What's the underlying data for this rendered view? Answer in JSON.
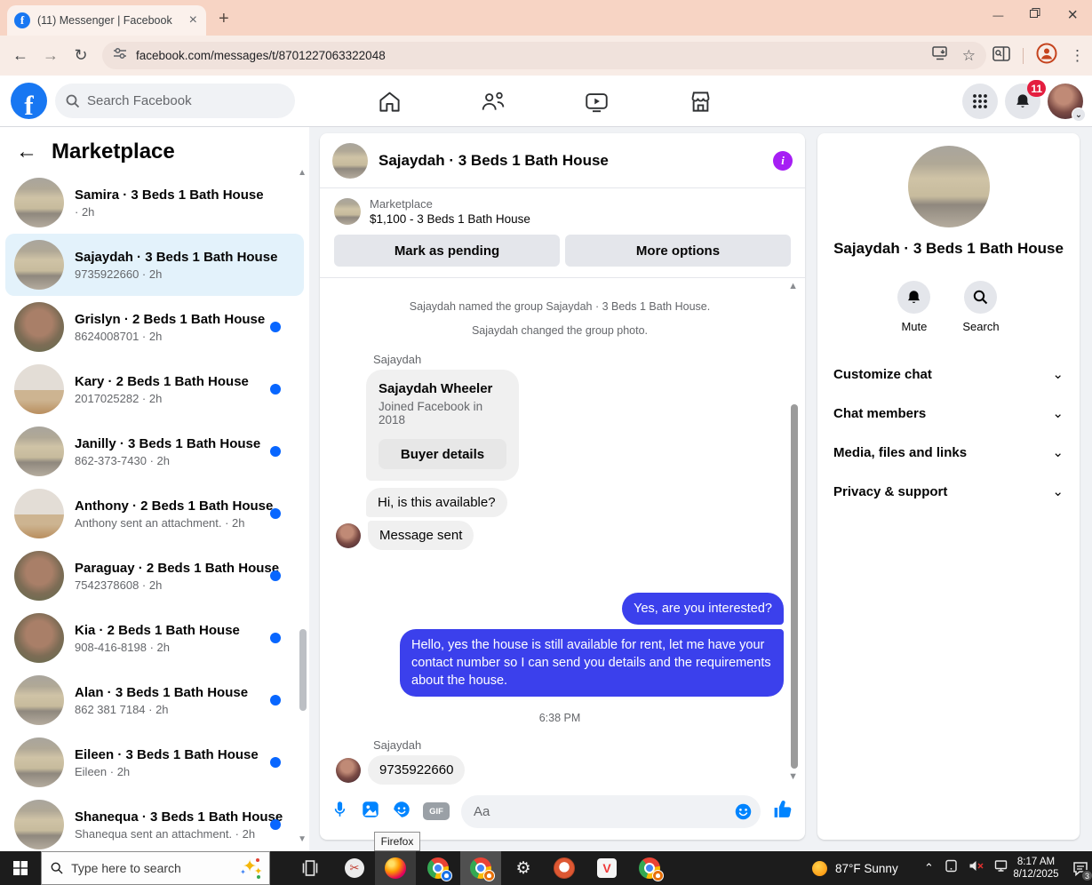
{
  "icons": {
    "close": "×",
    "minimize": "—",
    "newtab": "+",
    "back": "←",
    "forward": "→",
    "reload": "↻",
    "star": "☆",
    "kebab": "⋮",
    "chevron_down": "⌄",
    "scroll_up": "▲",
    "scroll_down": "▼",
    "info": "i",
    "gif": "GIF",
    "f_logo": "f",
    "gear": "⚙",
    "scissors": "✂",
    "vivaldi": "V",
    "tray_chevron": "⌃"
  },
  "colors": {
    "accent_blue": "#0084ff",
    "outgoing_bubble": "#3b40ec",
    "unread_dot": "#0866ff",
    "theme_info": "#a61ef4",
    "notification_red": "#e41e3f",
    "browser_theme": "#f7d4c4"
  },
  "browser": {
    "tab_title": "(11) Messenger | Facebook",
    "url": "facebook.com/messages/t/8701227063322048"
  },
  "fb_header": {
    "search_placeholder": "Search Facebook",
    "notification_badge": "11"
  },
  "sidebar": {
    "title": "Marketplace",
    "conversations": [
      {
        "name": "Samira · 3 Beds 1 Bath House",
        "preview": "· 2h",
        "unread": false,
        "selected": false,
        "avatar": "av-tan"
      },
      {
        "name": "Sajaydah · 3 Beds 1 Bath House",
        "preview": "9735922660 · 2h",
        "unread": false,
        "selected": true,
        "avatar": "av-tan"
      },
      {
        "name": "Grislyn · 2 Beds 1 Bath House",
        "preview": "8624008701 · 2h",
        "unread": true,
        "selected": false,
        "avatar": "av-brick"
      },
      {
        "name": "Kary · 2 Beds 1 Bath House",
        "preview": "2017025282 · 2h",
        "unread": true,
        "selected": false,
        "avatar": "av-room"
      },
      {
        "name": "Janilly · 3 Beds 1 Bath House",
        "preview": "862-373-7430 · 2h",
        "unread": true,
        "selected": false,
        "avatar": "av-tan"
      },
      {
        "name": "Anthony · 2 Beds 1 Bath House",
        "preview": "Anthony sent an attachment. · 2h",
        "unread": true,
        "selected": false,
        "avatar": "av-room"
      },
      {
        "name": "Paraguay · 2 Beds 1 Bath House",
        "preview": "7542378608 · 2h",
        "unread": true,
        "selected": false,
        "avatar": "av-brick"
      },
      {
        "name": "Kia · 2 Beds 1 Bath House",
        "preview": "908-416-8198 · 2h",
        "unread": true,
        "selected": false,
        "avatar": "av-brick"
      },
      {
        "name": "Alan · 3 Beds 1 Bath House",
        "preview": "862 381 7184 · 2h",
        "unread": true,
        "selected": false,
        "avatar": "av-tan"
      },
      {
        "name": "Eileen · 3 Beds 1 Bath House",
        "preview": "Eileen · 2h",
        "unread": true,
        "selected": false,
        "avatar": "av-tan"
      },
      {
        "name": "Shanequa · 3 Beds 1 Bath House",
        "preview": "Shanequa sent an attachment. · 2h",
        "unread": true,
        "selected": false,
        "avatar": "av-tan"
      }
    ]
  },
  "chat": {
    "title": "Sajaydah · 3 Beds 1 Bath House",
    "marketplace_label": "Marketplace",
    "price_line": "$1,100 - 3 Beds 1 Bath House",
    "mark_pending_label": "Mark as pending",
    "more_options_label": "More options",
    "system_msg_1": "Sajaydah named the group Sajaydah · 3 Beds 1 Bath House.",
    "system_msg_2": "Sajaydah changed the group photo.",
    "sender_name": "Sajaydah",
    "profile_card": {
      "name": "Sajaydah Wheeler",
      "joined": "Joined Facebook in 2018",
      "button_label": "Buyer details"
    },
    "incoming_msg_1": "Hi, is this available?",
    "incoming_msg_2": "Message sent",
    "outgoing_msg_1": "Yes, are you interested?",
    "outgoing_msg_2": "Hello, yes the house is still available for rent, let me have your contact number so I can send you details and the requirements about the house.",
    "timestamp": "6:38 PM",
    "sender_name_2": "Sajaydah",
    "incoming_msg_3": "9735922660",
    "composer_placeholder": "Aa"
  },
  "details": {
    "title": "Sajaydah · 3 Beds 1 Bath House",
    "mute_label": "Mute",
    "search_label": "Search",
    "sections": [
      "Customize chat",
      "Chat members",
      "Media, files and links",
      "Privacy & support"
    ]
  },
  "taskbar": {
    "search_placeholder": "Type here to search",
    "weather": "87°F Sunny",
    "time": "8:17 AM",
    "date": "8/12/2025",
    "notification_badge": "3",
    "tooltip": "Firefox"
  }
}
